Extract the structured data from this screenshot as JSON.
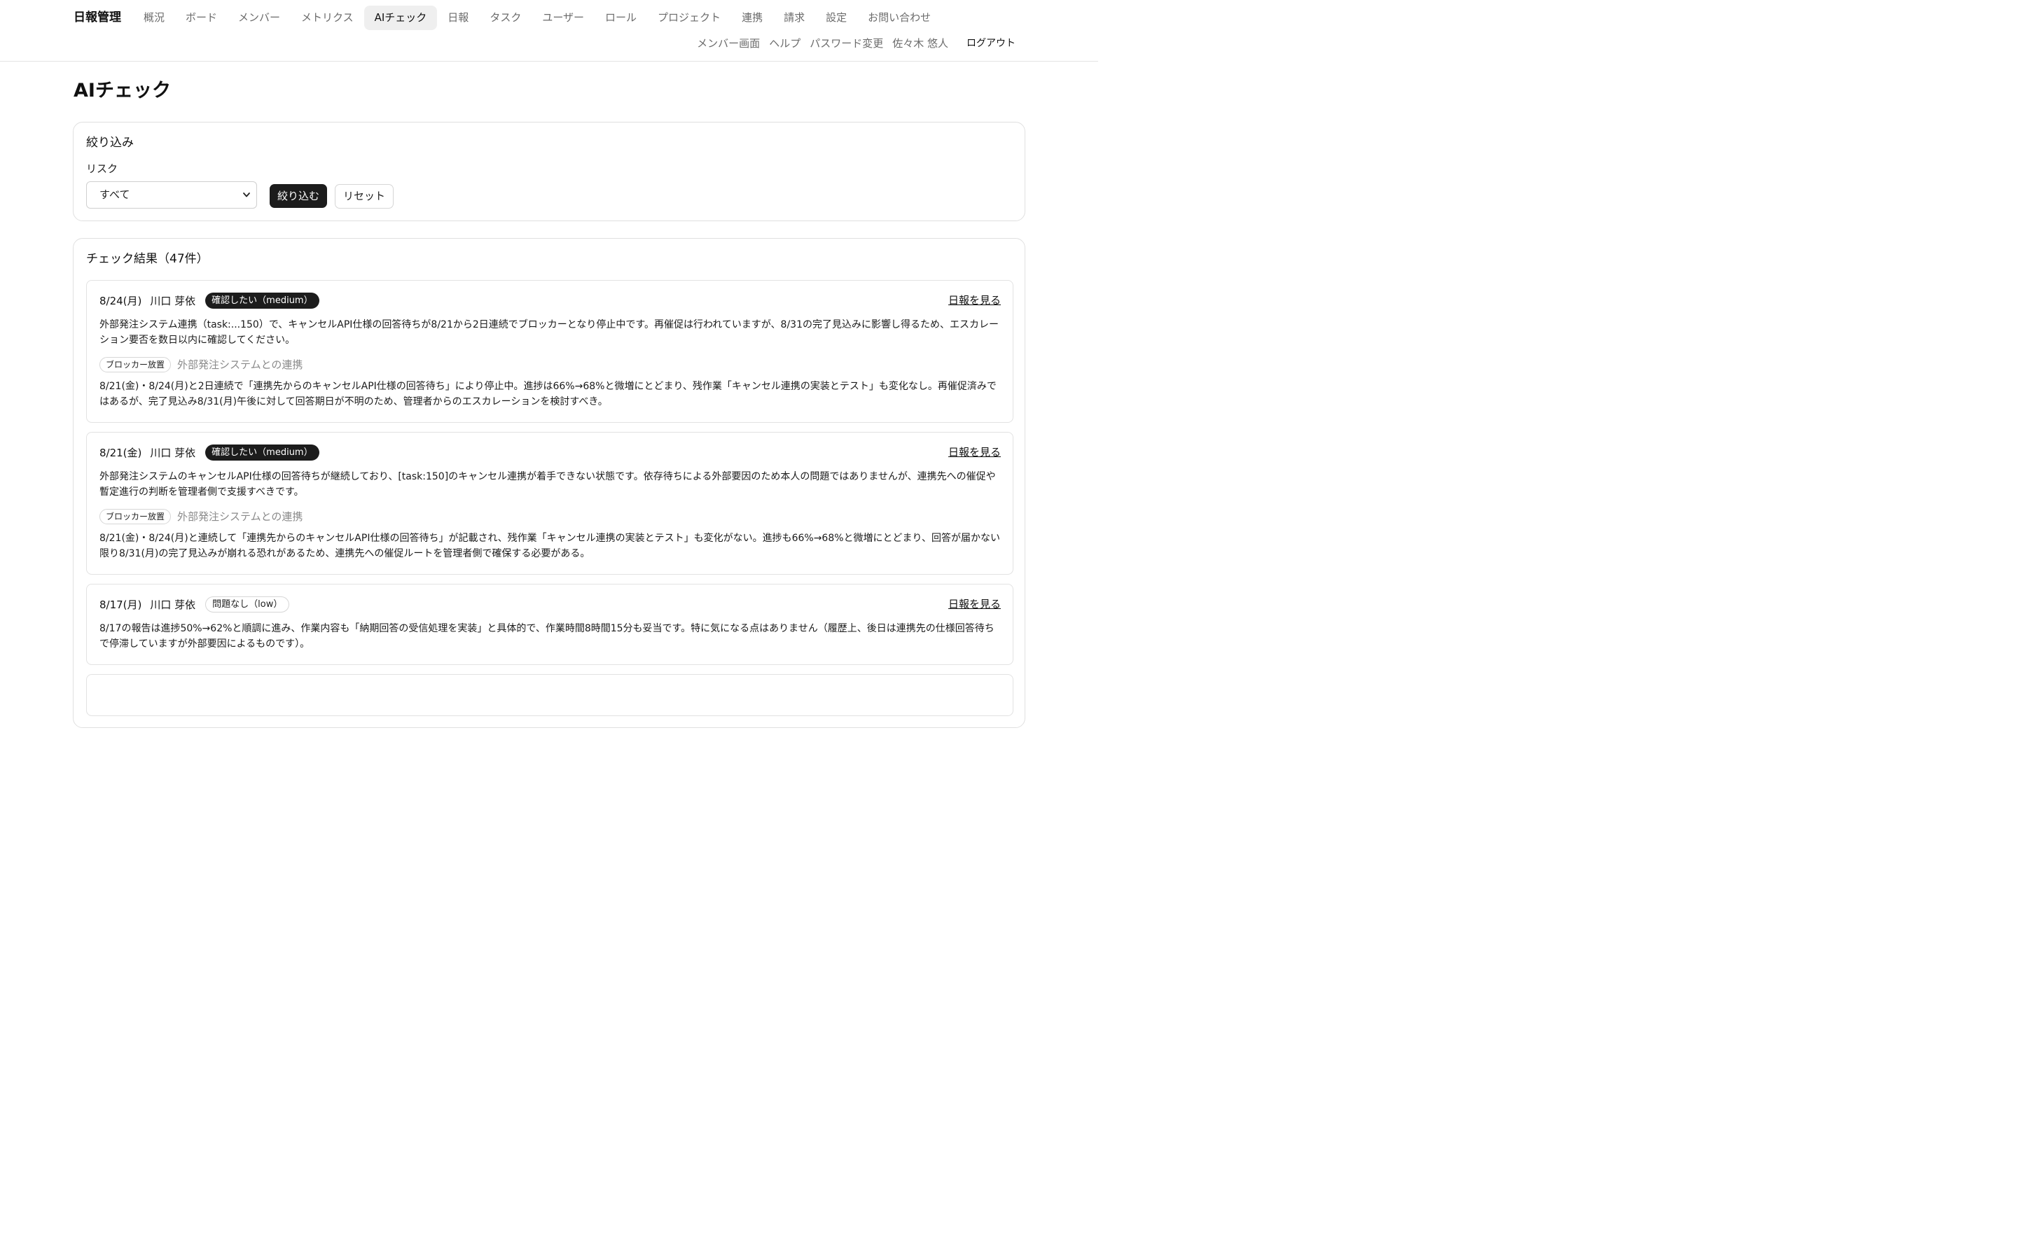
{
  "header": {
    "brand": "日報管理",
    "nav": [
      {
        "label": "概況",
        "active": false
      },
      {
        "label": "ボード",
        "active": false
      },
      {
        "label": "メンバー",
        "active": false
      },
      {
        "label": "メトリクス",
        "active": false
      },
      {
        "label": "AIチェック",
        "active": true
      },
      {
        "label": "日報",
        "active": false
      },
      {
        "label": "タスク",
        "active": false
      },
      {
        "label": "ユーザー",
        "active": false
      },
      {
        "label": "ロール",
        "active": false
      },
      {
        "label": "プロジェクト",
        "active": false
      },
      {
        "label": "連携",
        "active": false
      },
      {
        "label": "請求",
        "active": false
      },
      {
        "label": "設定",
        "active": false
      },
      {
        "label": "お問い合わせ",
        "active": false
      }
    ],
    "subnav": {
      "member_view": "メンバー画面",
      "help": "ヘルプ",
      "password": "パスワード変更",
      "user_name": "佐々木 悠人",
      "logout": "ログアウト"
    }
  },
  "page": {
    "title": "AIチェック"
  },
  "filter": {
    "title": "絞り込み",
    "risk_label": "リスク",
    "risk_value": "すべて",
    "submit_label": "絞り込む",
    "reset_label": "リセット"
  },
  "results": {
    "title": "チェック結果（47件）",
    "entries": [
      {
        "date": "8/24(月)",
        "user": "川口 芽依",
        "badge": "確認したい（medium）",
        "link": "日報を見る",
        "summary": "外部発注システム連携（task:...150）で、キャンセルAPI仕様の回答待ちが8/21から2日連続でブロッカーとなり停止中です。再催促は行われていますが、8/31の完了見込みに影響し得るため、エスカレーション要否を数日以内に確認してください。",
        "tag": "ブロッカー放置",
        "context": "外部発注システムとの連携",
        "detail": "8/21(金)・8/24(月)と2日連続で「連携先からのキャンセルAPI仕様の回答待ち」により停止中。進捗は66%→68%と微増にとどまり、残作業「キャンセル連携の実装とテスト」も変化なし。再催促済みではあるが、完了見込み8/31(月)午後に対して回答期日が不明のため、管理者からのエスカレーションを検討すべき。"
      },
      {
        "date": "8/21(金)",
        "user": "川口 芽依",
        "badge": "確認したい（medium）",
        "link": "日報を見る",
        "summary": "外部発注システムのキャンセルAPI仕様の回答待ちが継続しており、[task:150]のキャンセル連携が着手できない状態です。依存待ちによる外部要因のため本人の問題ではありませんが、連携先への催促や暫定進行の判断を管理者側で支援すべきです。",
        "tag": "ブロッカー放置",
        "context": "外部発注システムとの連携",
        "detail": "8/21(金)・8/24(月)と連続して「連携先からのキャンセルAPI仕様の回答待ち」が記載され、残作業「キャンセル連携の実装とテスト」も変化がない。進捗も66%→68%と微増にとどまり、回答が届かない限り8/31(月)の完了見込みが崩れる恐れがあるため、連携先への催促ルートを管理者側で確保する必要がある。"
      },
      {
        "date": "8/17(月)",
        "user": "川口 芽依",
        "badge": "問題なし（low）",
        "link": "日報を見る",
        "summary": "8/17の報告は進捗50%→62%と順調に進み、作業内容も「納期回答の受信処理を実装」と具体的で、作業時間8時間15分も妥当です。特に気になる点はありません（履歴上、後日は連携先の仕様回答待ちで停滞していますが外部要因によるものです）。"
      }
    ]
  }
}
